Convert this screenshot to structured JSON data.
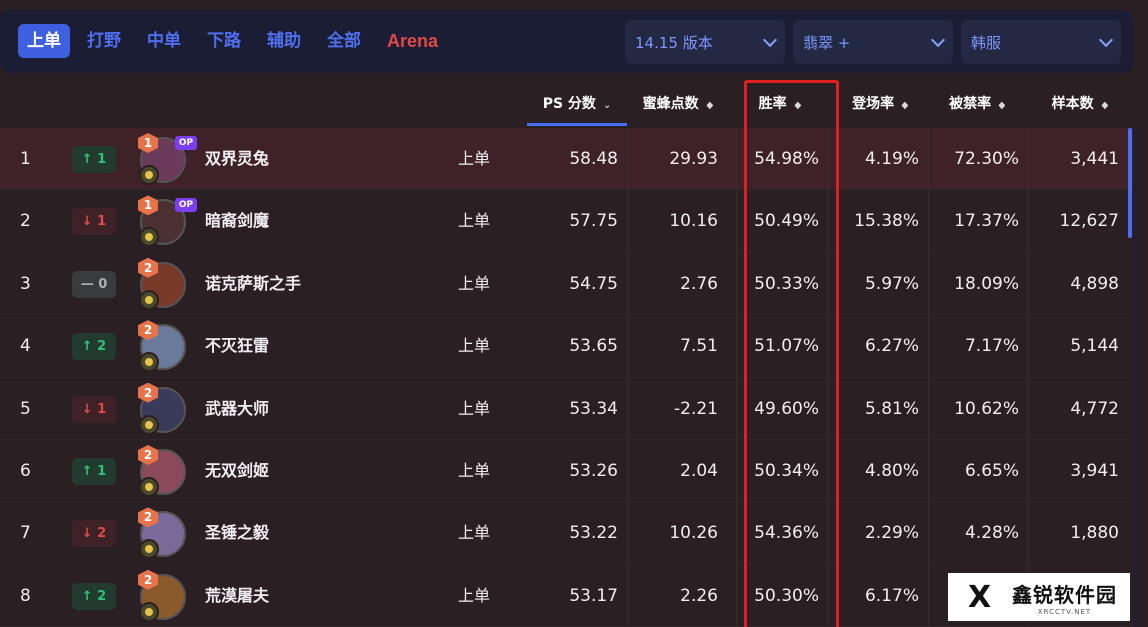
{
  "roles": [
    {
      "label": "上单",
      "active": true
    },
    {
      "label": "打野",
      "active": false
    },
    {
      "label": "中单",
      "active": false
    },
    {
      "label": "下路",
      "active": false
    },
    {
      "label": "辅助",
      "active": false
    },
    {
      "label": "全部",
      "active": false
    },
    {
      "label": "Arena",
      "active": false
    }
  ],
  "filters": {
    "version": "14.15 版本",
    "rank": "翡翠 +",
    "server": "韩服"
  },
  "columns": {
    "ps": "PS 分数",
    "mifeng": "蜜蜂点数",
    "winrate": "胜率",
    "pickrate": "登场率",
    "banrate": "被禁率",
    "samples": "样本数"
  },
  "rows": [
    {
      "rank": "1",
      "trend": "↑ 1",
      "trend_dir": "up",
      "tier": "1",
      "op": "OP",
      "name": "双界灵兔",
      "lane": "上单",
      "ps": "58.48",
      "mifeng": "29.93",
      "winrate": "54.98%",
      "pickrate": "4.19%",
      "banrate": "72.30%",
      "samples": "3,441",
      "avatar_color": "#6b3a5a"
    },
    {
      "rank": "2",
      "trend": "↓ 1",
      "trend_dir": "down",
      "tier": "1",
      "op": "OP",
      "name": "暗裔剑魔",
      "lane": "上单",
      "ps": "57.75",
      "mifeng": "10.16",
      "winrate": "50.49%",
      "pickrate": "15.38%",
      "banrate": "17.37%",
      "samples": "12,627",
      "avatar_color": "#4a3030"
    },
    {
      "rank": "3",
      "trend": "— 0",
      "trend_dir": "same",
      "tier": "2",
      "op": "",
      "name": "诺克萨斯之手",
      "lane": "上单",
      "ps": "54.75",
      "mifeng": "2.76",
      "winrate": "50.33%",
      "pickrate": "5.97%",
      "banrate": "18.09%",
      "samples": "4,898",
      "avatar_color": "#7a3a2a"
    },
    {
      "rank": "4",
      "trend": "↑ 2",
      "trend_dir": "up",
      "tier": "2",
      "op": "",
      "name": "不灭狂雷",
      "lane": "上单",
      "ps": "53.65",
      "mifeng": "7.51",
      "winrate": "51.07%",
      "pickrate": "6.27%",
      "banrate": "7.17%",
      "samples": "5,144",
      "avatar_color": "#6a7a9a"
    },
    {
      "rank": "5",
      "trend": "↓ 1",
      "trend_dir": "down",
      "tier": "2",
      "op": "",
      "name": "武器大师",
      "lane": "上单",
      "ps": "53.34",
      "mifeng": "-2.21",
      "winrate": "49.60%",
      "pickrate": "5.81%",
      "banrate": "10.62%",
      "samples": "4,772",
      "avatar_color": "#3a3a5a"
    },
    {
      "rank": "6",
      "trend": "↑ 1",
      "trend_dir": "up",
      "tier": "2",
      "op": "",
      "name": "无双剑姬",
      "lane": "上单",
      "ps": "53.26",
      "mifeng": "2.04",
      "winrate": "50.34%",
      "pickrate": "4.80%",
      "banrate": "6.65%",
      "samples": "3,941",
      "avatar_color": "#8a4a5a"
    },
    {
      "rank": "7",
      "trend": "↓ 2",
      "trend_dir": "down",
      "tier": "2",
      "op": "",
      "name": "圣锤之毅",
      "lane": "上单",
      "ps": "53.22",
      "mifeng": "10.26",
      "winrate": "54.36%",
      "pickrate": "2.29%",
      "banrate": "4.28%",
      "samples": "1,880",
      "avatar_color": "#7a6a9a"
    },
    {
      "rank": "8",
      "trend": "↑ 2",
      "trend_dir": "up",
      "tier": "2",
      "op": "",
      "name": "荒漠屠夫",
      "lane": "上单",
      "ps": "53.17",
      "mifeng": "2.26",
      "winrate": "50.30%",
      "pickrate": "6.17%",
      "banrate": "",
      "samples": "",
      "avatar_color": "#8a5a2a"
    }
  ],
  "watermark": {
    "logo": "X",
    "cn": "鑫锐软件园",
    "en": "XRCCTV.NET"
  },
  "colors": {
    "accent": "#4c6ef5",
    "highlight_border": "#e02020",
    "trend_up": "#2ec27e",
    "trend_down": "#e04a4a"
  }
}
